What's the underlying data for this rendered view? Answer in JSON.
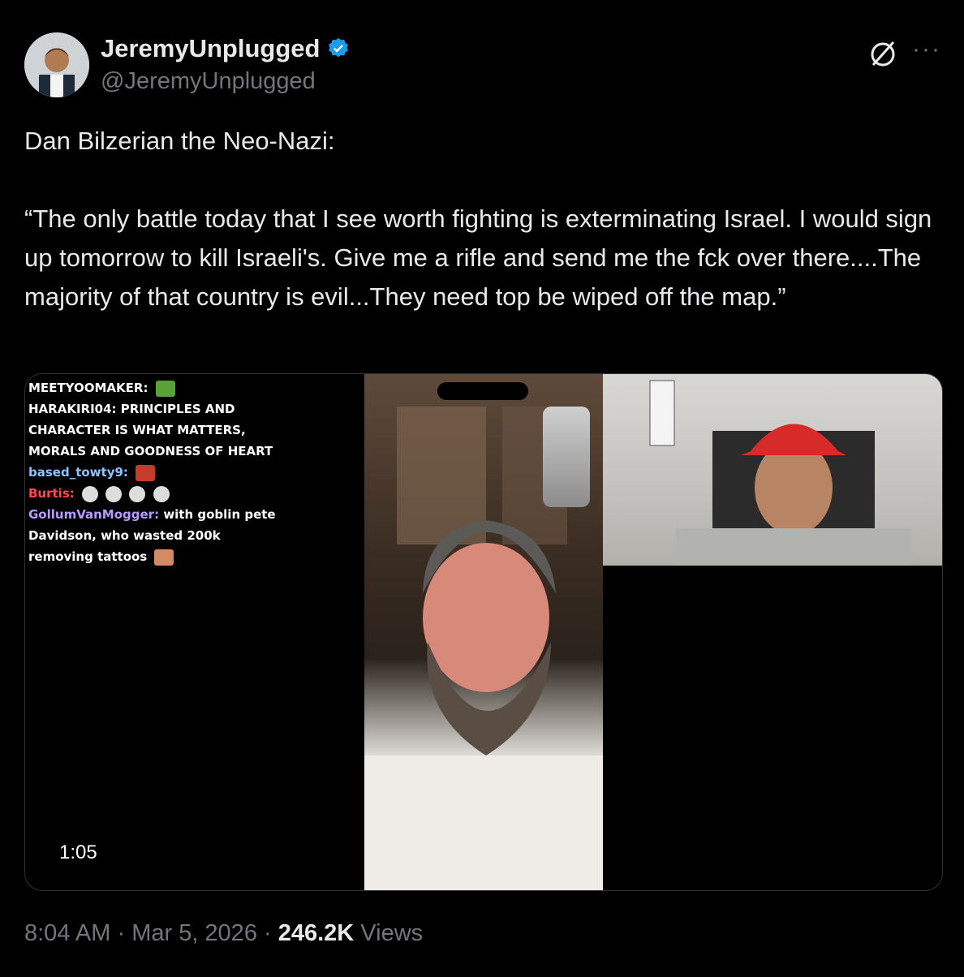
{
  "tweet": {
    "display_name": "JeremyUnplugged",
    "handle": "@JeremyUnplugged",
    "text": "Dan Bilzerian the Neo-Nazi:\n\n“The only battle today that I see worth fighting is exterminating Israel. I would sign up tomorrow to kill Israeli's. Give me a rifle and send me the fck over there....The majority of that country is evil...They need top be wiped off the map.”",
    "more_label": "···",
    "verified_color": "#1d9bf0",
    "icons": [
      "avatar",
      "verified-badge-icon",
      "grok-icon",
      "more-icon"
    ]
  },
  "media": {
    "timestamp": "1:05",
    "chat": [
      {
        "user": "MEETYOOMAKER:",
        "message": "",
        "emote": "green"
      },
      {
        "user": "HARAKIRI04:",
        "message": "PRINCIPLES AND CHARACTER IS WHAT MATTERS, MORALS AND GOODNESS OF HEART",
        "emote": ""
      },
      {
        "user": "based_towty9:",
        "message": "",
        "emote": "red"
      },
      {
        "user": "Burtis:",
        "message": "",
        "emote": "faces"
      },
      {
        "user": "GollumVanMogger:",
        "message": "with goblin pete Davidson, who wasted 200k removing tattoos",
        "emote": "tan"
      }
    ]
  },
  "footer": {
    "time": "8:04 AM",
    "sep1": " · ",
    "date": "Mar 5, 2026",
    "sep2": " · ",
    "views_count": "246.2K",
    "views_label": " Views"
  }
}
